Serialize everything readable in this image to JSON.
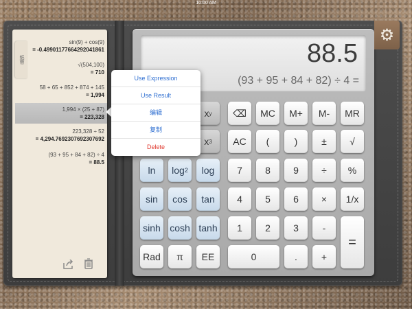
{
  "status_bar": {
    "time": "10:00 AM"
  },
  "tape": {
    "tab_label": "纸带",
    "entries": [
      {
        "expr": "sin(9) + cos(9)",
        "res": "= -0.49901177664292041861"
      },
      {
        "expr": "√(504,100)",
        "res": "= 710"
      },
      {
        "expr": "58 + 65 + 852 + 874 + 145",
        "res": "= 1,994"
      },
      {
        "expr": "1,994 × (25 + 87)",
        "res": "= 223,328"
      },
      {
        "expr": "223,328 ÷ 52",
        "res": "= 4,294.7692307692307692"
      },
      {
        "expr": "(93 + 95 + 84 + 82) ÷ 4",
        "res": "= 88.5"
      }
    ],
    "share_icon": "share-icon",
    "trash_icon": "trash-icon"
  },
  "display": {
    "value": "88.5",
    "expression": "(93 + 95 + 84 + 82) ÷ 4 ="
  },
  "menu": {
    "items": [
      "Use Expression",
      "Use Result",
      "编辑",
      "复制",
      "Delete"
    ]
  },
  "keys": {
    "x2": "x",
    "x2_sup": "y",
    "x3": "x",
    "x3_sup": "3",
    "backspace": "⌫",
    "mc": "MC",
    "mplus": "M+",
    "mminus": "M-",
    "mr": "MR",
    "ac": "AC",
    "lparen": "(",
    "rparen": ")",
    "plusminus": "±",
    "sqrt": "√",
    "ln": "ln",
    "log2": "log",
    "log2_sub": "2",
    "log": "log",
    "n7": "7",
    "n8": "8",
    "n9": "9",
    "div": "÷",
    "pct": "%",
    "sin": "sin",
    "cos": "cos",
    "tan": "tan",
    "n4": "4",
    "n5": "5",
    "n6": "6",
    "mul": "×",
    "inv": "1/x",
    "sinh": "sinh",
    "cosh": "cosh",
    "tanh": "tanh",
    "n1": "1",
    "n2": "2",
    "n3": "3",
    "minus": "-",
    "rad": "Rad",
    "pi": "π",
    "ee": "EE",
    "n0": "0",
    "dot": ".",
    "plus": "+",
    "equals": "="
  },
  "colors": {
    "menu_text": "#2f6fd1",
    "delete_text": "#e03a2f",
    "accent_blue_key": "#c7d9ea"
  }
}
